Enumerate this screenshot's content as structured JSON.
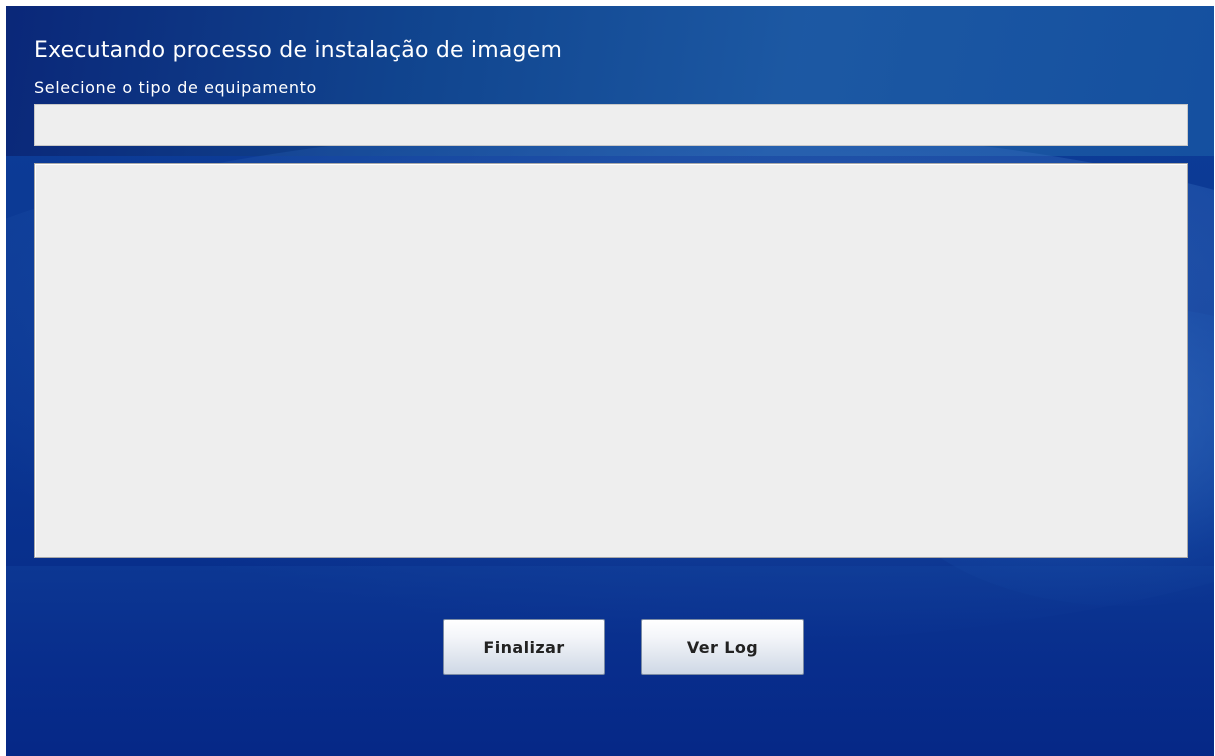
{
  "window": {
    "title": "Executando processo de instalação de imagem",
    "subtitle": "Selecione o tipo de equipamento"
  },
  "equipment_field": {
    "value": ""
  },
  "log_area": {
    "value": ""
  },
  "buttons": {
    "finalizar_label": "Finalizar",
    "ver_log_label": "Ver Log"
  },
  "colors": {
    "background_primary": "#0a2f8c",
    "background_highlight": "#1d5aa4",
    "field_background": "#eeeeee",
    "text_on_background": "#ffffff",
    "button_text": "#222222"
  }
}
